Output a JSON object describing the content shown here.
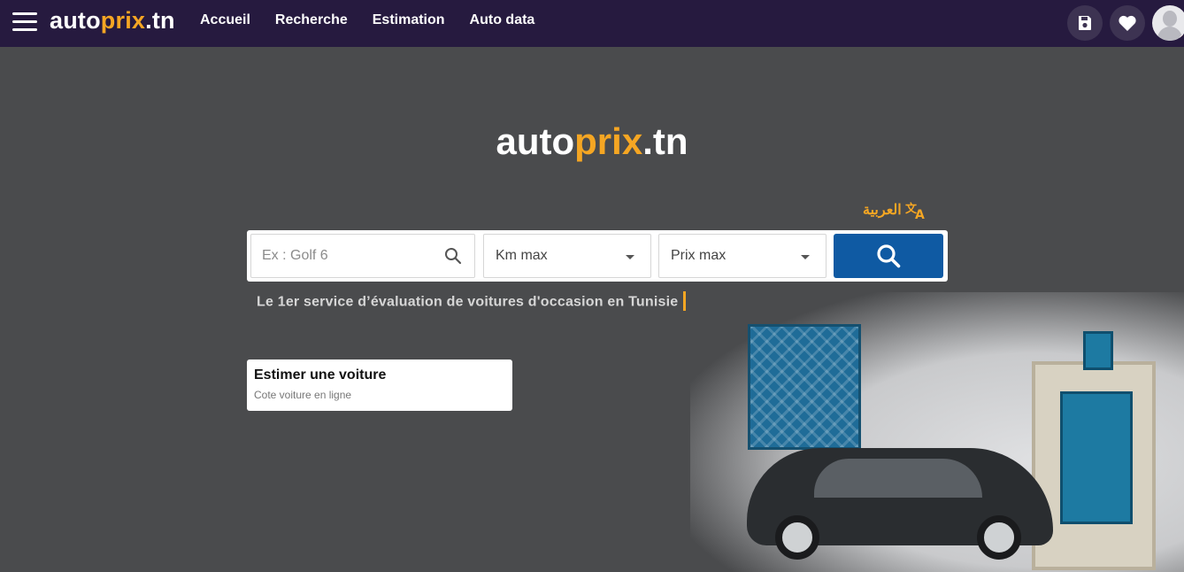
{
  "brand": {
    "prefix": "auto",
    "highlight": "prix",
    "suffix": ".tn"
  },
  "nav": {
    "items": [
      {
        "label": "Accueil"
      },
      {
        "label": "Recherche"
      },
      {
        "label": "Estimation"
      },
      {
        "label": "Auto data"
      }
    ]
  },
  "topbar_icons": [
    "save-icon",
    "heart-icon",
    "user-avatar"
  ],
  "hero": {
    "logo": {
      "prefix": "auto",
      "highlight": "prix",
      "suffix": ".tn"
    },
    "language_label": "العربية",
    "tagline": "Le 1er service d’évaluation de voitures d'occasion en Tunisie"
  },
  "search": {
    "keyword_placeholder": "Ex : Golf 6",
    "km_label": "Km max",
    "prix_label": "Prix max"
  },
  "estimate_card": {
    "title": "Estimer une voiture",
    "subtitle": "Cote voiture en ligne"
  },
  "colors": {
    "topbar": "#261a3f",
    "background": "#4a4b4d",
    "accent": "#f5a623",
    "submit_button": "#0f5aa3"
  }
}
